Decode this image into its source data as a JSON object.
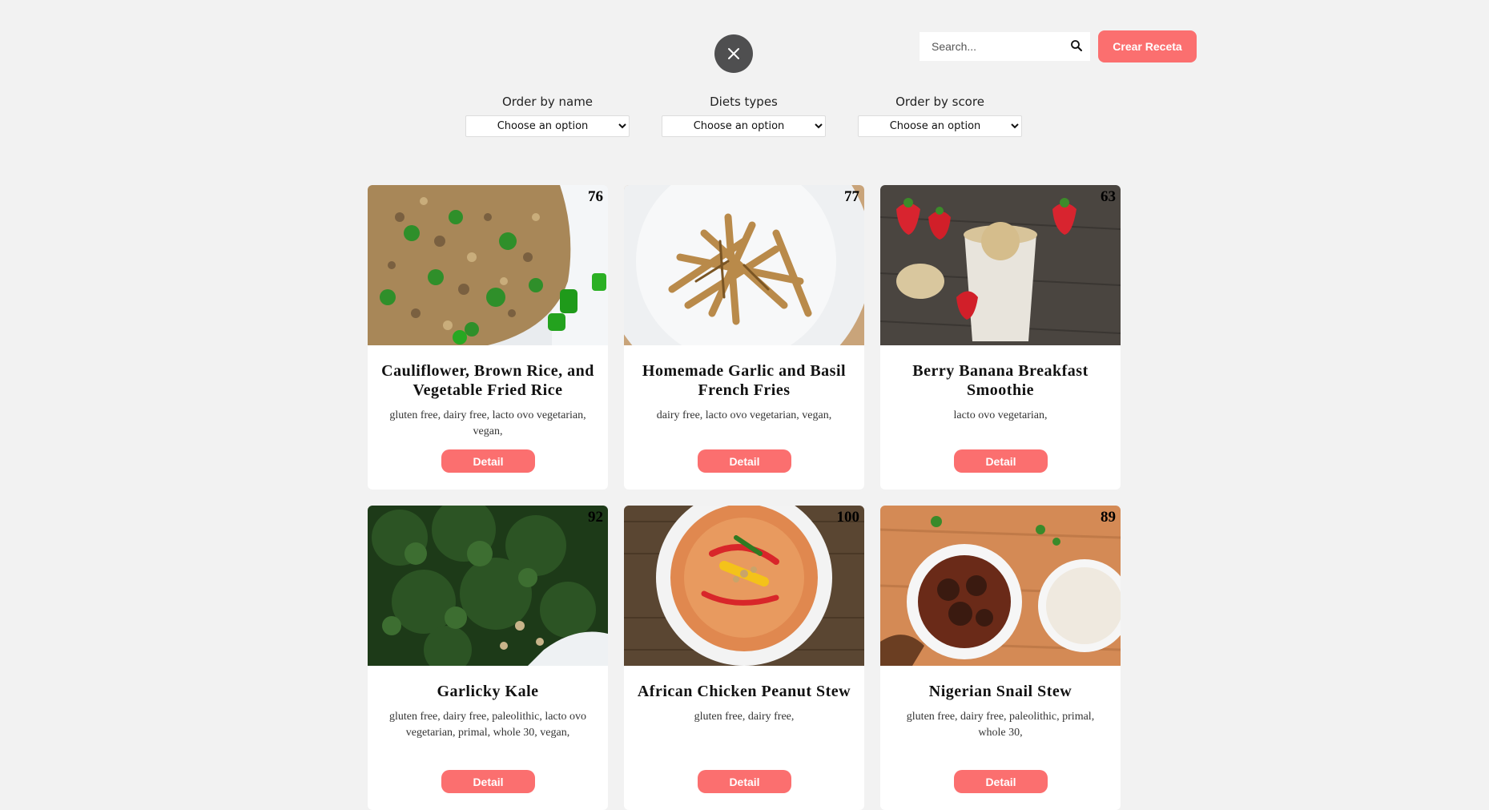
{
  "header": {
    "search_placeholder": "Search...",
    "create_label": "Crear Receta"
  },
  "filters": [
    {
      "label": "Order by name",
      "selected": "Choose an option"
    },
    {
      "label": "Diets types",
      "selected": "Choose an option"
    },
    {
      "label": "Order by score",
      "selected": "Choose an option"
    }
  ],
  "cards": [
    {
      "score": "76",
      "title": "Cauliflower, Brown Rice, and Vegetable Fried Rice",
      "diets": "gluten free, dairy free, lacto ovo vegetarian, vegan,",
      "button": "Detail"
    },
    {
      "score": "77",
      "title": "Homemade Garlic and Basil French Fries",
      "diets": "dairy free, lacto ovo vegetarian, vegan,",
      "button": "Detail"
    },
    {
      "score": "63",
      "title": "Berry Banana Breakfast Smoothie",
      "diets": "lacto ovo vegetarian,",
      "button": "Detail"
    },
    {
      "score": "92",
      "title": "Garlicky Kale",
      "diets": "gluten free, dairy free, paleolithic, lacto ovo vegetarian, primal, whole 30, vegan,",
      "button": "Detail"
    },
    {
      "score": "100",
      "title": "African Chicken Peanut Stew",
      "diets": "gluten free, dairy free,",
      "button": "Detail"
    },
    {
      "score": "89",
      "title": "Nigerian Snail Stew",
      "diets": "gluten free, dairy free, paleolithic, primal, whole 30,",
      "button": "Detail"
    }
  ],
  "colors": {
    "accent": "#fb6f6f",
    "background": "#f2f2f2",
    "close_button": "#4f4f50"
  }
}
